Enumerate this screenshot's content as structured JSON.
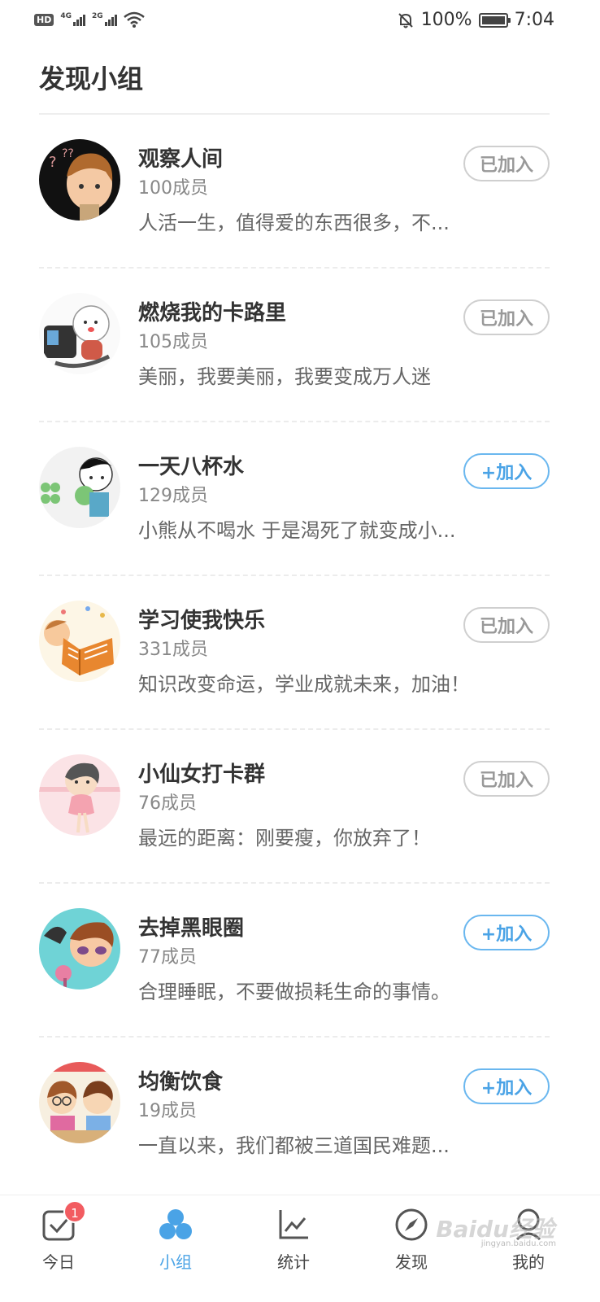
{
  "status_bar": {
    "hd": "HD",
    "net1": "4G",
    "net2": "2G",
    "battery_percent": "100%",
    "time": "7:04"
  },
  "page_title": "发现小组",
  "groups": [
    {
      "name": "观察人间",
      "members": "100成员",
      "desc": "人活一生，值得爱的东西很多，不...",
      "button": "已加入",
      "joined": true
    },
    {
      "name": "燃烧我的卡路里",
      "members": "105成员",
      "desc": "美丽，我要美丽，我要变成万人迷",
      "button": "已加入",
      "joined": true
    },
    {
      "name": "一天八杯水",
      "members": "129成员",
      "desc": "小熊从不喝水 于是渴死了就变成小...",
      "button": "+加入",
      "joined": false
    },
    {
      "name": "学习使我快乐",
      "members": "331成员",
      "desc": "知识改变命运，学业成就未来，加油！",
      "button": "已加入",
      "joined": true
    },
    {
      "name": "小仙女打卡群",
      "members": "76成员",
      "desc": "最远的距离：刚要瘦，你放弃了！",
      "button": "已加入",
      "joined": true
    },
    {
      "name": "去掉黑眼圈",
      "members": "77成员",
      "desc": "合理睡眠，不要做损耗生命的事情。",
      "button": "+加入",
      "joined": false
    },
    {
      "name": "均衡饮食",
      "members": "19成员",
      "desc": "一直以来，我们都被三道国民难题...",
      "button": "+加入",
      "joined": false
    }
  ],
  "tabs": [
    {
      "label": "今日",
      "icon": "checkbox-icon",
      "badge": "1"
    },
    {
      "label": "小组",
      "icon": "group-icon",
      "active": true
    },
    {
      "label": "统计",
      "icon": "chart-icon"
    },
    {
      "label": "发现",
      "icon": "compass-icon"
    },
    {
      "label": "我的",
      "icon": "profile-icon"
    }
  ],
  "watermark": "Baidu经验",
  "watermark_sub": "jingyan.baidu.com",
  "colors": {
    "accent": "#4aa3e6",
    "badge": "#f25c61",
    "joined_border": "#cfcfcf"
  }
}
